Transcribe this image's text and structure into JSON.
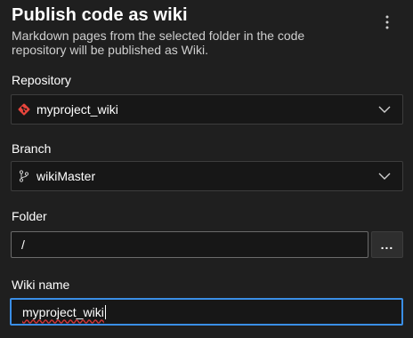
{
  "header": {
    "title": "Publish code as wiki",
    "more_icon": "more-vertical-icon"
  },
  "description": {
    "line1": "Markdown pages from the selected folder in the code",
    "line2": "repository will be published as Wiki."
  },
  "repository": {
    "label": "Repository",
    "value": "myproject_wiki",
    "icon": "git-repo-icon",
    "icon_color": "#e8453c"
  },
  "branch": {
    "label": "Branch",
    "value": "wikiMaster",
    "icon": "git-branch-icon"
  },
  "folder": {
    "label": "Folder",
    "value": "/",
    "browse_label": "..."
  },
  "wiki_name": {
    "label": "Wiki name",
    "value": "myproject_wiki"
  },
  "colors": {
    "background": "#1f1f1f",
    "focus_border": "#3a8ee6",
    "spellcheck_underline": "#d13438"
  }
}
